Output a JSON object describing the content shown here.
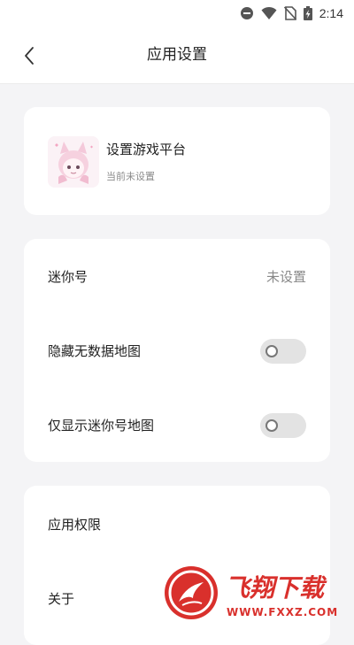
{
  "status_bar": {
    "time": "2:14",
    "icons": [
      "do-not-disturb-icon",
      "wifi-icon",
      "no-sim-icon",
      "battery-charging-icon"
    ]
  },
  "header": {
    "title": "应用设置",
    "back_icon": "chevron-left-icon"
  },
  "platform_card": {
    "title": "设置游戏平台",
    "subtitle": "当前未设置",
    "avatar": "anime-avatar"
  },
  "settings": {
    "mini_id": {
      "label": "迷你号",
      "value": "未设置"
    },
    "hide_no_data_maps": {
      "label": "隐藏无数据地图",
      "enabled": false
    },
    "show_mini_id_maps_only": {
      "label": "仅显示迷你号地图",
      "enabled": false
    }
  },
  "more": {
    "permissions_label": "应用权限",
    "about_label": "关于"
  },
  "watermark": {
    "brand": "飞翔下载",
    "domain": "WWW.FXXZ.COM"
  },
  "colors": {
    "page_bg": "#f4f4f6",
    "card_bg": "#ffffff",
    "toggle_off": "#e3e3e3",
    "muted_text": "#888888",
    "watermark_red": "#d9302c"
  }
}
